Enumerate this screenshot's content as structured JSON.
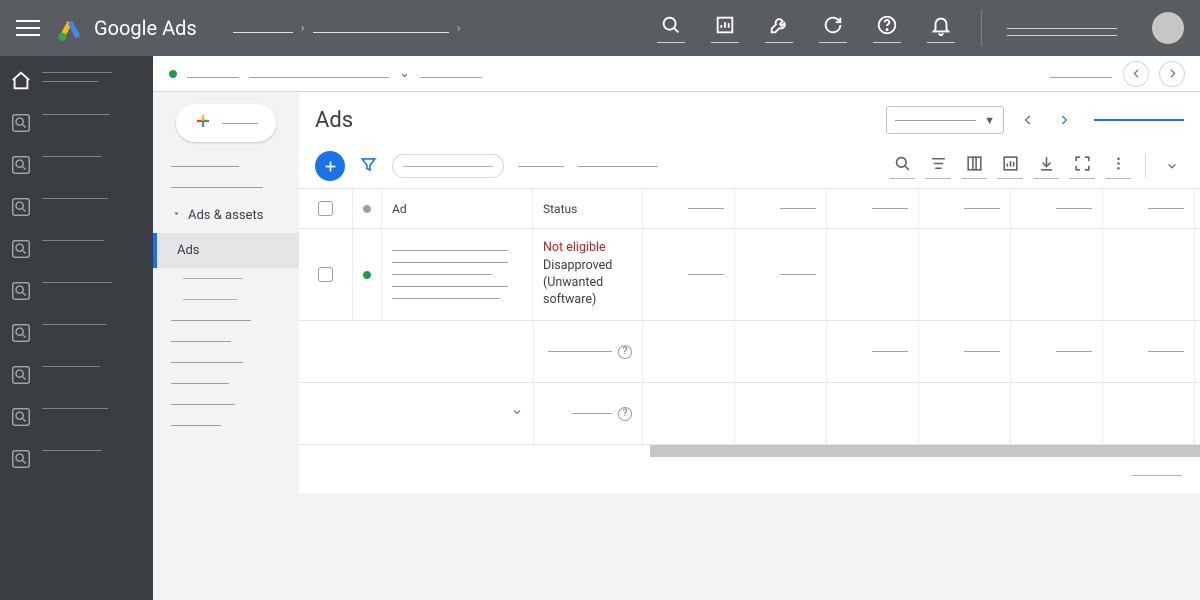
{
  "header": {
    "product": "Google Ads"
  },
  "secondary_nav": {
    "group_label": "Ads & assets",
    "active_item": "Ads"
  },
  "page": {
    "title": "Ads"
  },
  "table": {
    "headers": {
      "ad": "Ad",
      "status": "Status"
    },
    "rows": [
      {
        "status_title": "Not eligible",
        "status_detail": "Disapproved (Unwanted software)"
      }
    ]
  }
}
